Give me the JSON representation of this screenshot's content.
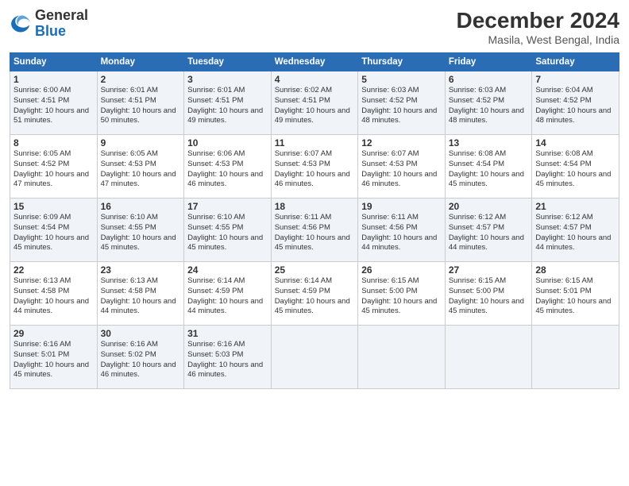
{
  "logo": {
    "text_general": "General",
    "text_blue": "Blue"
  },
  "title": "December 2024",
  "subtitle": "Masila, West Bengal, India",
  "headers": [
    "Sunday",
    "Monday",
    "Tuesday",
    "Wednesday",
    "Thursday",
    "Friday",
    "Saturday"
  ],
  "weeks": [
    [
      {
        "day": "1",
        "sunrise": "Sunrise: 6:00 AM",
        "sunset": "Sunset: 4:51 PM",
        "daylight": "Daylight: 10 hours and 51 minutes."
      },
      {
        "day": "2",
        "sunrise": "Sunrise: 6:01 AM",
        "sunset": "Sunset: 4:51 PM",
        "daylight": "Daylight: 10 hours and 50 minutes."
      },
      {
        "day": "3",
        "sunrise": "Sunrise: 6:01 AM",
        "sunset": "Sunset: 4:51 PM",
        "daylight": "Daylight: 10 hours and 49 minutes."
      },
      {
        "day": "4",
        "sunrise": "Sunrise: 6:02 AM",
        "sunset": "Sunset: 4:51 PM",
        "daylight": "Daylight: 10 hours and 49 minutes."
      },
      {
        "day": "5",
        "sunrise": "Sunrise: 6:03 AM",
        "sunset": "Sunset: 4:52 PM",
        "daylight": "Daylight: 10 hours and 48 minutes."
      },
      {
        "day": "6",
        "sunrise": "Sunrise: 6:03 AM",
        "sunset": "Sunset: 4:52 PM",
        "daylight": "Daylight: 10 hours and 48 minutes."
      },
      {
        "day": "7",
        "sunrise": "Sunrise: 6:04 AM",
        "sunset": "Sunset: 4:52 PM",
        "daylight": "Daylight: 10 hours and 48 minutes."
      }
    ],
    [
      {
        "day": "8",
        "sunrise": "Sunrise: 6:05 AM",
        "sunset": "Sunset: 4:52 PM",
        "daylight": "Daylight: 10 hours and 47 minutes."
      },
      {
        "day": "9",
        "sunrise": "Sunrise: 6:05 AM",
        "sunset": "Sunset: 4:53 PM",
        "daylight": "Daylight: 10 hours and 47 minutes."
      },
      {
        "day": "10",
        "sunrise": "Sunrise: 6:06 AM",
        "sunset": "Sunset: 4:53 PM",
        "daylight": "Daylight: 10 hours and 46 minutes."
      },
      {
        "day": "11",
        "sunrise": "Sunrise: 6:07 AM",
        "sunset": "Sunset: 4:53 PM",
        "daylight": "Daylight: 10 hours and 46 minutes."
      },
      {
        "day": "12",
        "sunrise": "Sunrise: 6:07 AM",
        "sunset": "Sunset: 4:53 PM",
        "daylight": "Daylight: 10 hours and 46 minutes."
      },
      {
        "day": "13",
        "sunrise": "Sunrise: 6:08 AM",
        "sunset": "Sunset: 4:54 PM",
        "daylight": "Daylight: 10 hours and 45 minutes."
      },
      {
        "day": "14",
        "sunrise": "Sunrise: 6:08 AM",
        "sunset": "Sunset: 4:54 PM",
        "daylight": "Daylight: 10 hours and 45 minutes."
      }
    ],
    [
      {
        "day": "15",
        "sunrise": "Sunrise: 6:09 AM",
        "sunset": "Sunset: 4:54 PM",
        "daylight": "Daylight: 10 hours and 45 minutes."
      },
      {
        "day": "16",
        "sunrise": "Sunrise: 6:10 AM",
        "sunset": "Sunset: 4:55 PM",
        "daylight": "Daylight: 10 hours and 45 minutes."
      },
      {
        "day": "17",
        "sunrise": "Sunrise: 6:10 AM",
        "sunset": "Sunset: 4:55 PM",
        "daylight": "Daylight: 10 hours and 45 minutes."
      },
      {
        "day": "18",
        "sunrise": "Sunrise: 6:11 AM",
        "sunset": "Sunset: 4:56 PM",
        "daylight": "Daylight: 10 hours and 45 minutes."
      },
      {
        "day": "19",
        "sunrise": "Sunrise: 6:11 AM",
        "sunset": "Sunset: 4:56 PM",
        "daylight": "Daylight: 10 hours and 44 minutes."
      },
      {
        "day": "20",
        "sunrise": "Sunrise: 6:12 AM",
        "sunset": "Sunset: 4:57 PM",
        "daylight": "Daylight: 10 hours and 44 minutes."
      },
      {
        "day": "21",
        "sunrise": "Sunrise: 6:12 AM",
        "sunset": "Sunset: 4:57 PM",
        "daylight": "Daylight: 10 hours and 44 minutes."
      }
    ],
    [
      {
        "day": "22",
        "sunrise": "Sunrise: 6:13 AM",
        "sunset": "Sunset: 4:58 PM",
        "daylight": "Daylight: 10 hours and 44 minutes."
      },
      {
        "day": "23",
        "sunrise": "Sunrise: 6:13 AM",
        "sunset": "Sunset: 4:58 PM",
        "daylight": "Daylight: 10 hours and 44 minutes."
      },
      {
        "day": "24",
        "sunrise": "Sunrise: 6:14 AM",
        "sunset": "Sunset: 4:59 PM",
        "daylight": "Daylight: 10 hours and 44 minutes."
      },
      {
        "day": "25",
        "sunrise": "Sunrise: 6:14 AM",
        "sunset": "Sunset: 4:59 PM",
        "daylight": "Daylight: 10 hours and 45 minutes."
      },
      {
        "day": "26",
        "sunrise": "Sunrise: 6:15 AM",
        "sunset": "Sunset: 5:00 PM",
        "daylight": "Daylight: 10 hours and 45 minutes."
      },
      {
        "day": "27",
        "sunrise": "Sunrise: 6:15 AM",
        "sunset": "Sunset: 5:00 PM",
        "daylight": "Daylight: 10 hours and 45 minutes."
      },
      {
        "day": "28",
        "sunrise": "Sunrise: 6:15 AM",
        "sunset": "Sunset: 5:01 PM",
        "daylight": "Daylight: 10 hours and 45 minutes."
      }
    ],
    [
      {
        "day": "29",
        "sunrise": "Sunrise: 6:16 AM",
        "sunset": "Sunset: 5:01 PM",
        "daylight": "Daylight: 10 hours and 45 minutes."
      },
      {
        "day": "30",
        "sunrise": "Sunrise: 6:16 AM",
        "sunset": "Sunset: 5:02 PM",
        "daylight": "Daylight: 10 hours and 46 minutes."
      },
      {
        "day": "31",
        "sunrise": "Sunrise: 6:16 AM",
        "sunset": "Sunset: 5:03 PM",
        "daylight": "Daylight: 10 hours and 46 minutes."
      },
      {
        "day": "",
        "sunrise": "",
        "sunset": "",
        "daylight": ""
      },
      {
        "day": "",
        "sunrise": "",
        "sunset": "",
        "daylight": ""
      },
      {
        "day": "",
        "sunrise": "",
        "sunset": "",
        "daylight": ""
      },
      {
        "day": "",
        "sunrise": "",
        "sunset": "",
        "daylight": ""
      }
    ]
  ]
}
